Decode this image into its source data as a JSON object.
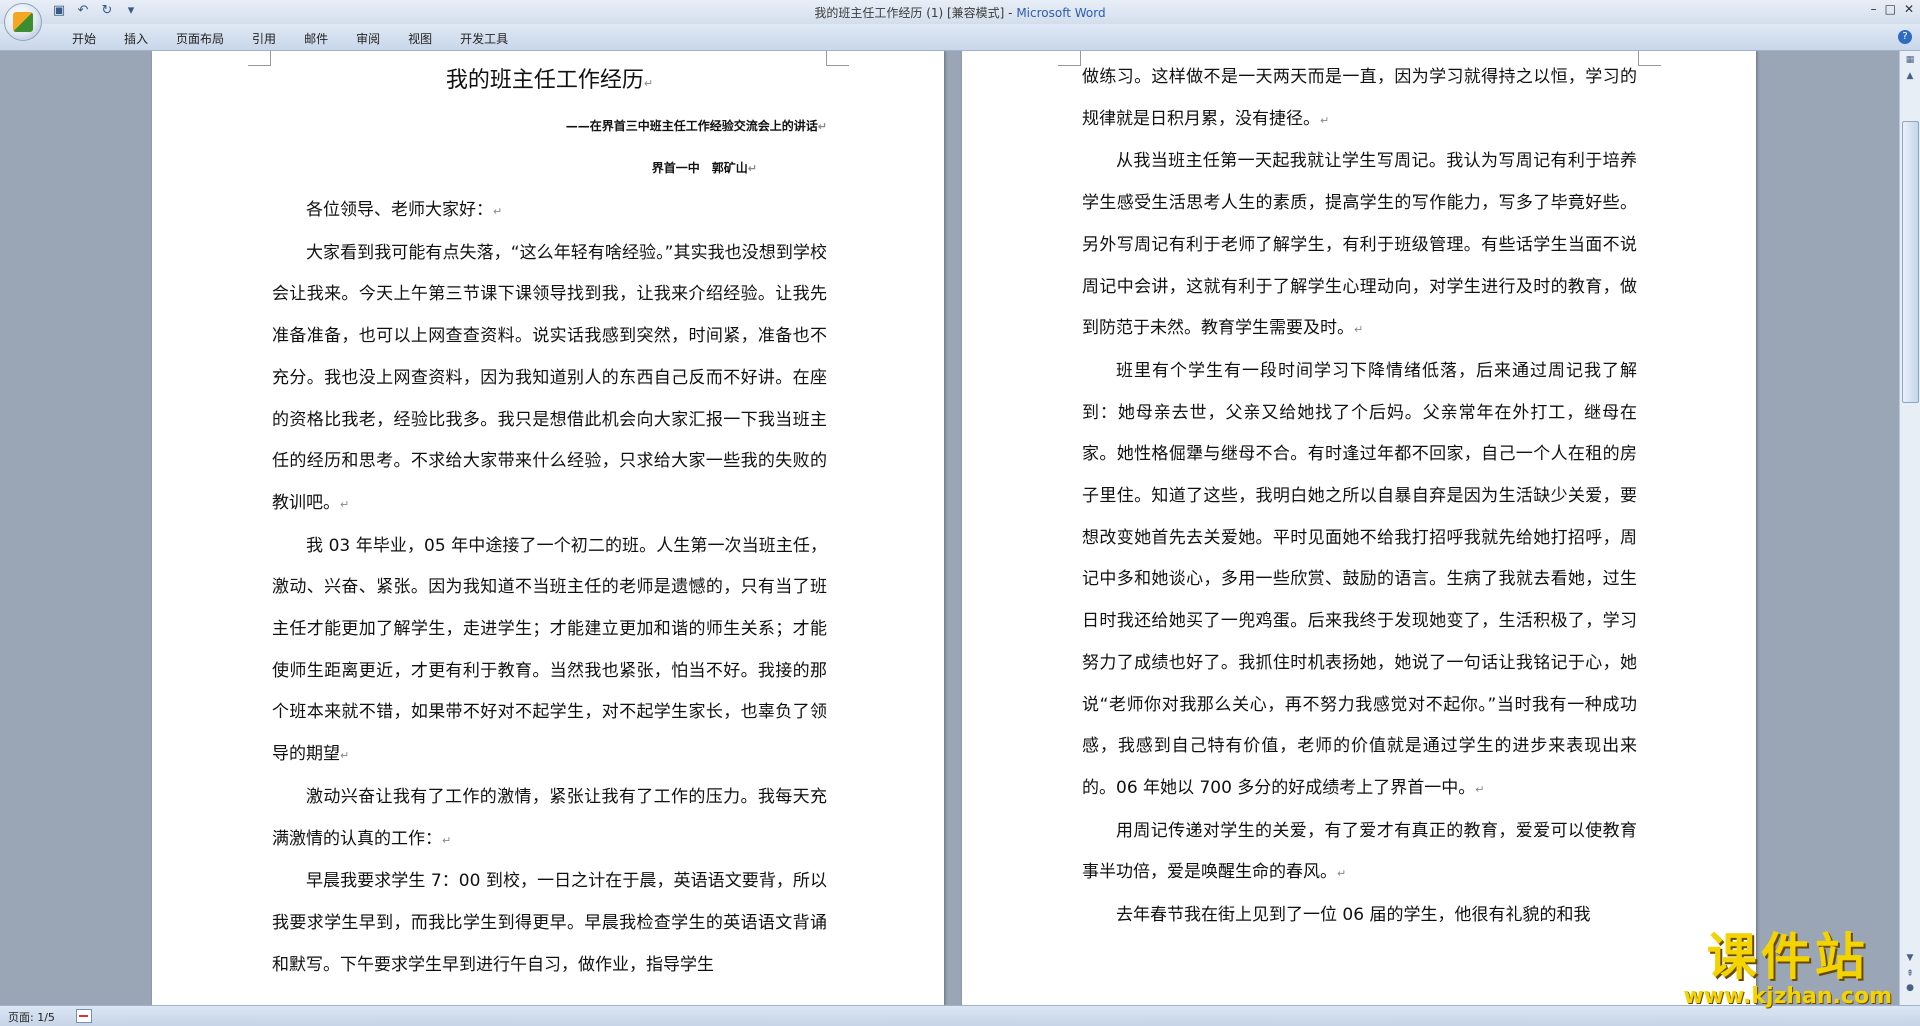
{
  "window": {
    "title_doc": "我的班主任工作经历 (1) [兼容模式] - ",
    "title_app": "Microsoft Word",
    "controls": [
      "–",
      "□",
      "✕"
    ]
  },
  "ribbon": {
    "tabs": [
      "开始",
      "插入",
      "页面布局",
      "引用",
      "邮件",
      "审阅",
      "视图",
      "开发工具"
    ],
    "help_label": "?"
  },
  "left_page": {
    "title": "我的班主任工作经历",
    "subtitle": "——在界首三中班主任工作经验交流会上的讲话",
    "author": "界首一中　郭矿山",
    "paragraphs": [
      "各位领导、老师大家好：",
      "大家看到我可能有点失落，“这么年轻有啥经验。”其实我也没想到学校会让我来。今天上午第三节课下课领导找到我，让我来介绍经验。让我先准备准备，也可以上网查查资料。说实话我感到突然，时间紧，准备也不充分。我也没上网查资料，因为我知道别人的东西自己反而不好讲。在座的资格比我老，经验比我多。我只是想借此机会向大家汇报一下我当班主任的经历和思考。不求给大家带来什么经验，只求给大家一些我的失败的教训吧。",
      "我 03 年毕业，05 年中途接了一个初二的班。人生第一次当班主任，激动、兴奋、紧张。因为我知道不当班主任的老师是遗憾的，只有当了班主任才能更加了解学生，走进学生；才能建立更加和谐的师生关系；才能使师生距离更近，才更有利于教育。当然我也紧张，怕当不好。我接的那个班本来就不错，如果带不好对不起学生，对不起学生家长，也辜负了领导的期望",
      "激动兴奋让我有了工作的激情，紧张让我有了工作的压力。我每天充满激情的认真的工作：",
      "早晨我要求学生 7：00 到校，一日之计在于晨，英语语文要背，所以我要求学生早到，而我比学生到得更早。早晨我检查学生的英语语文背诵和默写。下午要求学生早到进行午自习，做作业，指导学生"
    ]
  },
  "right_page": {
    "paragraphs": [
      "做练习。这样做不是一天两天而是一直，因为学习就得持之以恒，学习的规律就是日积月累，没有捷径。",
      "从我当班主任第一天起我就让学生写周记。我认为写周记有利于培养学生感受生活思考人生的素质，提高学生的写作能力，写多了毕竟好些。另外写周记有利于老师了解学生，有利于班级管理。有些话学生当面不说周记中会讲，这就有利于了解学生心理动向，对学生进行及时的教育，做到防范于未然。教育学生需要及时。",
      "班里有个学生有一段时间学习下降情绪低落，后来通过周记我了解到：她母亲去世，父亲又给她找了个后妈。父亲常年在外打工，继母在家。她性格倔犟与继母不合。有时逢过年都不回家，自己一个人在租的房子里住。知道了这些，我明白她之所以自暴自弃是因为生活缺少关爱，要想改变她首先去关爱她。平时见面她不给我打招呼我就先给她打招呼，周记中多和她谈心，多用一些欣赏、鼓励的语言。生病了我就去看她，过生日时我还给她买了一兜鸡蛋。后来我终于发现她变了，生活积极了，学习努力了成绩也好了。我抓住时机表扬她，她说了一句话让我铭记于心，她说“老师你对我那么关心，再不努力我感觉对不起你。”当时我有一种成功感，我感到自己特有价值，老师的价值就是通过学生的进步来表现出来的。06 年她以 700 多分的好成绩考上了界首一中。",
      "用周记传递对学生的关爱，有了爱才有真正的教育，爱爱可以使教育事半功倍，爱是唤醒生命的春风。",
      "去年春节我在街上见到了一位 06 届的学生，他很有礼貌的和我"
    ]
  },
  "paragraph_mark": "↵",
  "statusbar": {
    "page_info": "页面: 1/5"
  },
  "watermark": {
    "text": "课件站",
    "url": "www.kjzhan.com"
  }
}
